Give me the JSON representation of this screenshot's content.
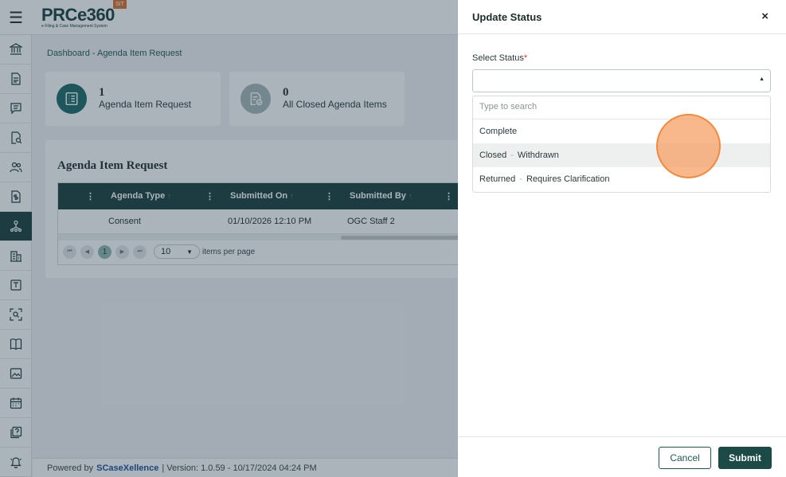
{
  "app": {
    "logo": "PRCe360",
    "logo_tagline": "e-Filing & Case Management System",
    "env_badge": "SIT"
  },
  "sidebar": {
    "icons": [
      "bank-icon",
      "document-icon",
      "chat-icon",
      "file-search-icon",
      "people-icon",
      "file-dollar-icon",
      "workflow-icon",
      "building-icon",
      "template-icon",
      "scan-search-icon",
      "book-icon",
      "image-icon",
      "calendar-icon",
      "help-book-icon",
      "bell-icon"
    ]
  },
  "breadcrumb": "Dashboard - Agenda Item Request",
  "cards": [
    {
      "count": "1",
      "label": "Agenda Item Request"
    },
    {
      "count": "0",
      "label": "All Closed Agenda Items"
    }
  ],
  "panel": {
    "title": "Agenda Item Request",
    "columns": [
      "Agenda Type",
      "Submitted On",
      "Submitted By"
    ],
    "rows": [
      {
        "agenda_type": "Consent",
        "submitted_on": "01/10/2026 12:10 PM",
        "submitted_by": "OGC Staff 2"
      }
    ],
    "pager": {
      "current_page": "1",
      "page_size": "10",
      "items_per_page_label": "items per page"
    }
  },
  "footer": {
    "powered_by": "Powered by",
    "brand": "CaseXellence",
    "version": "|  Version: 1.0.59 - 10/17/2024 04:24 PM"
  },
  "drawer": {
    "title": "Update Status",
    "close_label": "×",
    "field_label": "Select Status",
    "required_mark": "*",
    "search_placeholder": "Type to search",
    "options": [
      {
        "main": "Complete",
        "sub": ""
      },
      {
        "main": "Closed",
        "sub": "Withdrawn"
      },
      {
        "main": "Returned",
        "sub": "Requires Clarification"
      }
    ],
    "cancel_label": "Cancel",
    "submit_label": "Submit"
  }
}
